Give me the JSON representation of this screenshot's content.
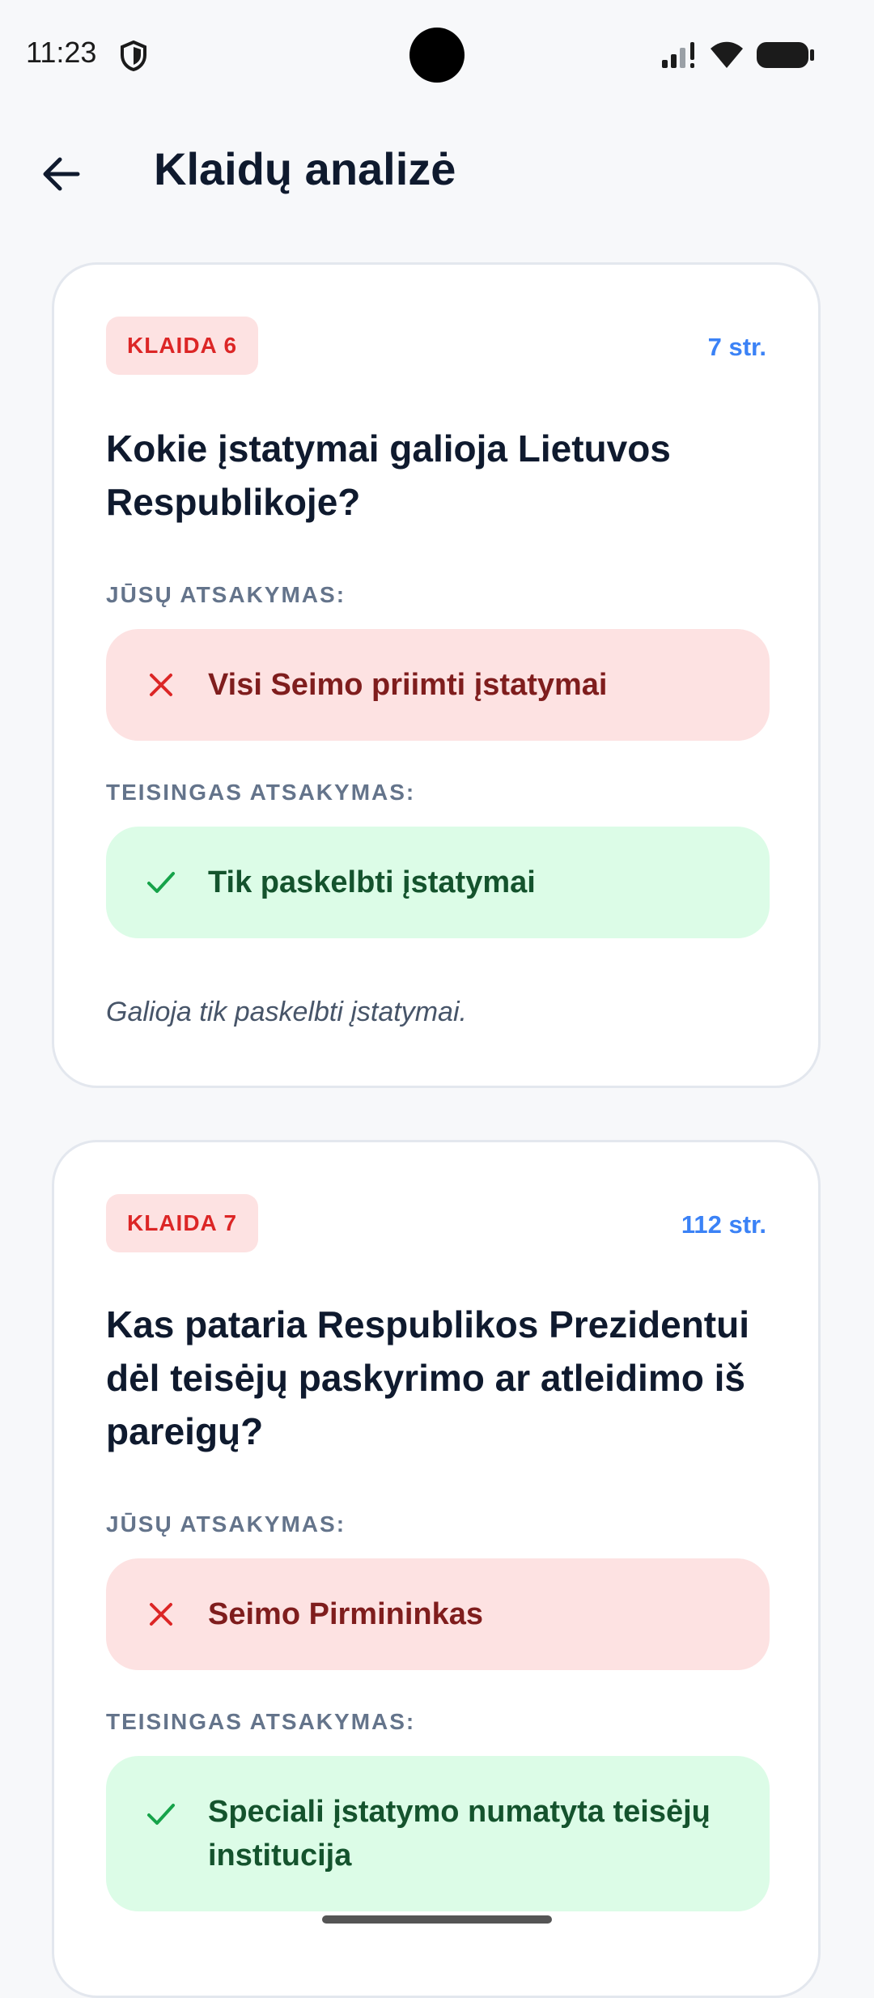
{
  "status_bar": {
    "time": "11:23"
  },
  "header": {
    "title": "Klaidų analizė"
  },
  "labels": {
    "your_answer": "JŪSŲ ATSAKYMAS:",
    "correct_answer": "TEISINGAS ATSAKYMAS:"
  },
  "mistakes": [
    {
      "badge": "KLAIDA 6",
      "article": "7 str.",
      "question": "Kokie įstatymai galioja Lietuvos Respublikoje?",
      "your_answer": "Visi Seimo priimti įstatymai",
      "correct_answer": "Tik paskelbti įstatymai",
      "explanation": "Galioja tik paskelbti įstatymai."
    },
    {
      "badge": "KLAIDA 7",
      "article": "112 str.",
      "question": "Kas pataria Respublikos Prezidentui dėl teisėjų paskyrimo ar atleidimo iš pareigų?",
      "your_answer": "Seimo Pirmininkas",
      "correct_answer": "Speciali įstatymo numatyta teisėjų institucija"
    }
  ],
  "colors": {
    "error": "#dc2626",
    "success": "#16a34a",
    "link": "#3b82f6"
  },
  "icons": [
    "shield-icon",
    "signal-icon",
    "wifi-icon",
    "battery-icon",
    "back-arrow-icon",
    "cross-icon",
    "check-icon"
  ]
}
